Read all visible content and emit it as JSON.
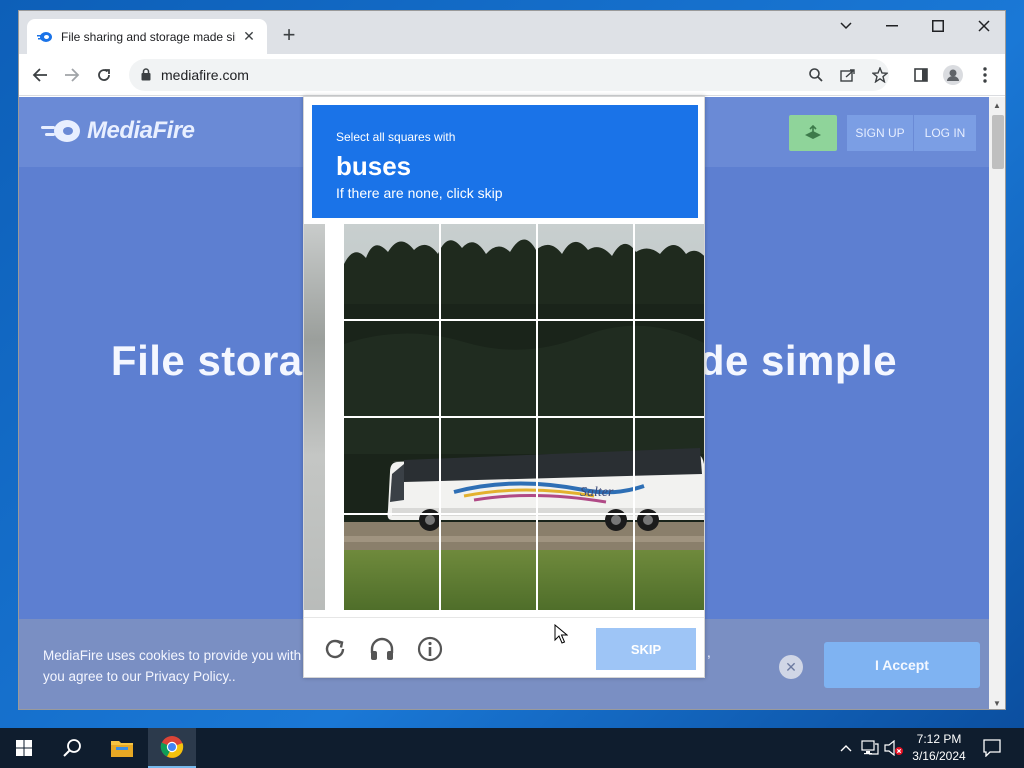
{
  "browser": {
    "tab_title": "File sharing and storage made simple",
    "tab_favicon": "mediafire-flame-icon",
    "url": "mediafire.com"
  },
  "site": {
    "logo_text": "MediaFire",
    "signup_label": "SIGN UP",
    "login_label": "LOG IN",
    "hero_left": "File storag",
    "hero_right": "de simple",
    "cookie_line1": "MediaFire uses cookies to provide you with",
    "cookie_line2": "you agree to our Privacy Policy..",
    "cookie_trailing": ",",
    "accept_label": "I Accept",
    "colors": {
      "page_bg": "#5d7fd1",
      "accept_btn": "#7fb3f2",
      "upload_btn": "#8fd49a"
    }
  },
  "captcha": {
    "select_text": "Select all squares with",
    "target": "buses",
    "hint": "If there are none, click skip",
    "skip_label": "SKIP",
    "bus_text": "Salter",
    "footer_icons": [
      "refresh-icon",
      "headphones-icon",
      "info-icon"
    ],
    "header_color": "#1a73e8"
  },
  "taskbar": {
    "time": "7:12 PM",
    "date": "3/16/2024",
    "pinned": [
      "start-icon",
      "search-icon",
      "file-explorer-icon",
      "chrome-icon"
    ]
  }
}
